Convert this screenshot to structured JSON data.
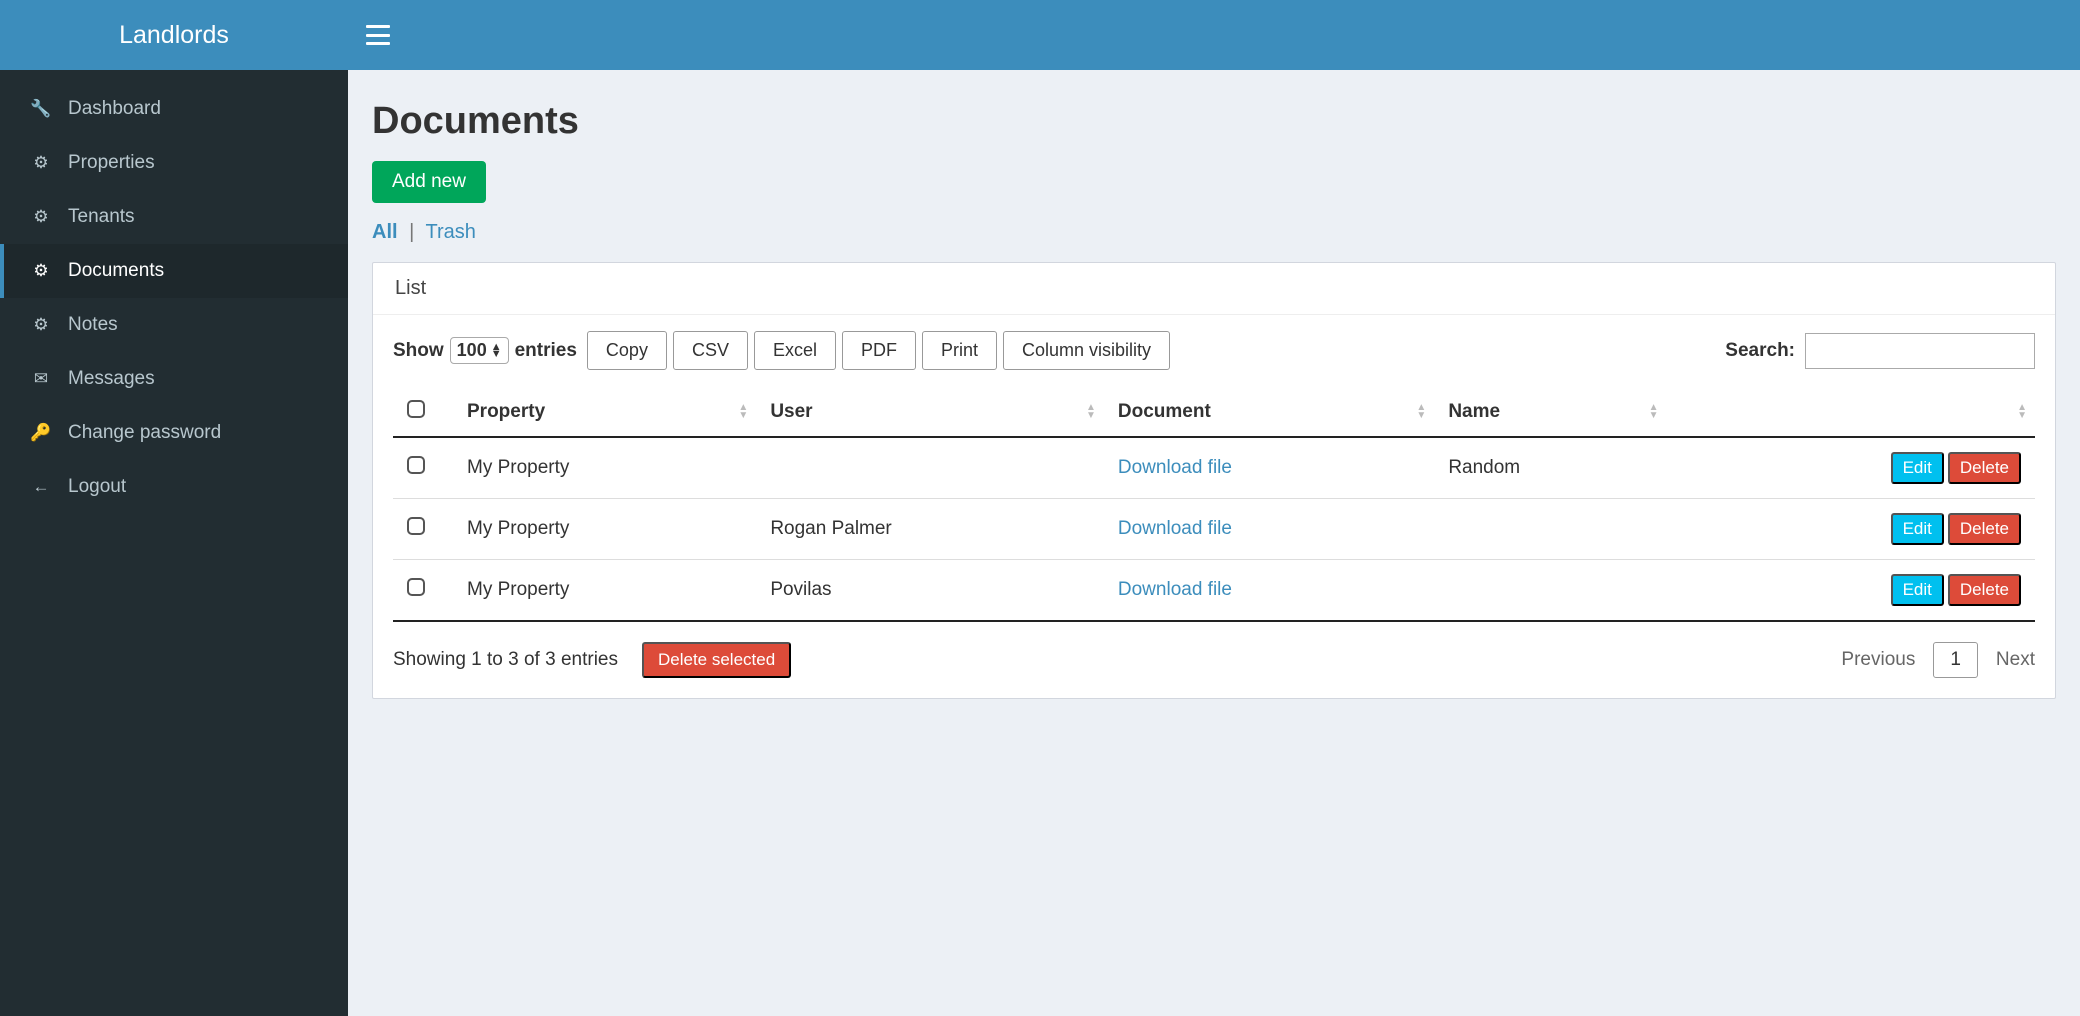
{
  "brand": "Landlords",
  "sidebar": {
    "items": [
      {
        "label": "Dashboard",
        "icon": "wrench"
      },
      {
        "label": "Properties",
        "icon": "gears"
      },
      {
        "label": "Tenants",
        "icon": "gears"
      },
      {
        "label": "Documents",
        "icon": "gears",
        "active": true
      },
      {
        "label": "Notes",
        "icon": "gears"
      },
      {
        "label": "Messages",
        "icon": "envelope"
      },
      {
        "label": "Change password",
        "icon": "key"
      },
      {
        "label": "Logout",
        "icon": "arrow-left"
      }
    ]
  },
  "page": {
    "title": "Documents",
    "add_new_label": "Add new",
    "filters": {
      "all": "All",
      "trash": "Trash",
      "separator": "|"
    }
  },
  "panel": {
    "header": "List",
    "show_label_pre": "Show",
    "show_label_post": "entries",
    "page_length": "100",
    "buttons": {
      "copy": "Copy",
      "csv": "CSV",
      "excel": "Excel",
      "pdf": "PDF",
      "print": "Print",
      "colvis": "Column visibility"
    },
    "search_label": "Search:",
    "search_value": ""
  },
  "table": {
    "headers": {
      "property": "Property",
      "user": "User",
      "document": "Document",
      "name": "Name"
    },
    "download_label": "Download file",
    "edit_label": "Edit",
    "delete_label": "Delete",
    "rows": [
      {
        "property": "My Property",
        "user": "",
        "name": "Random"
      },
      {
        "property": "My Property",
        "user": "Rogan Palmer",
        "name": ""
      },
      {
        "property": "My Property",
        "user": "Povilas",
        "name": ""
      }
    ]
  },
  "footer": {
    "info": "Showing 1 to 3 of 3 entries",
    "delete_selected": "Delete selected",
    "previous": "Previous",
    "page": "1",
    "next": "Next"
  }
}
